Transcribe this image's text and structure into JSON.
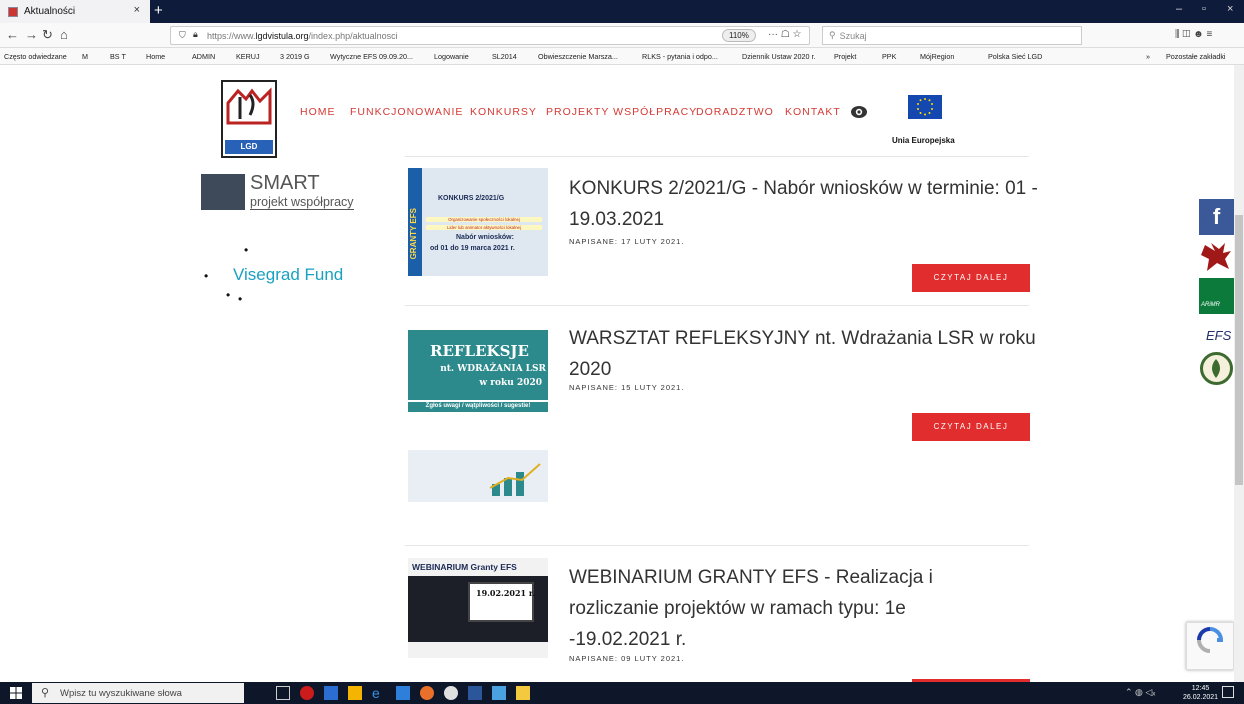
{
  "browser": {
    "tab_title": "Aktualności",
    "tab_close": "×",
    "new_tab": "+",
    "url_prefix": "https://www.",
    "url_host": "lgdvistula.org",
    "url_path": "/index.php/aktualnosci",
    "zoom": "110%",
    "url_actions": "··· ☖ ☆",
    "search_placeholder": "Szukaj",
    "window_controls": {
      "minimize": "–",
      "maximize": "▫",
      "close": "×"
    },
    "right_tools": "⫼ ◫ ☻ ≡"
  },
  "bookmarks": [
    "Często odwiedzane",
    "M",
    "BS T",
    "Home",
    "ADMIN",
    "KERUJ",
    "3 2019 G",
    "Wytyczne EFS 09.09.20...",
    "Logowanie",
    "SL2014",
    "Obwieszczenie Marsza...",
    "RLKS - pytania i odpo...",
    "Dziennik Ustaw 2020 r.",
    "Projekt",
    "PPK",
    "MójRegion",
    "Polska Sieć LGD"
  ],
  "bookmarks_overflow": "»",
  "bookmarks_other": "Pozostałe zakładki",
  "site": {
    "logo_text": "LGD",
    "menu": [
      "HOME",
      "FUNKCJONOWANIE",
      "KONKURSY",
      "PROJEKTY WSPÓŁPRACY",
      "DORADZTWO",
      "KONTAKT"
    ],
    "eu_label": "Unia Europejska"
  },
  "sidebar": {
    "smart_title": "SMART",
    "smart_subtitle": "projekt współpracy",
    "visegrad": "Visegrad Fund",
    "bullet": "•"
  },
  "posts": [
    {
      "title": "KONKURS 2/2021/G - Nabór wniosków w terminie: 01 - 19.03.2021",
      "date": "NAPISANE: 17 LUTY 2021.",
      "button": "CZYTAJ DALEJ",
      "thumb": {
        "side_label": "GRANTY EFS",
        "heading": "KONKURS 2/2021/G",
        "sub1": "Organizowanie społeczności lokalnej",
        "sub2": "Lider lub animator aktywności lokalnej",
        "cta": "Nabór wniosków:",
        "dates": "od 01 do 19 marca 2021 r."
      }
    },
    {
      "title": "WARSZTAT REFLEKSYJNY nt. Wdrażania LSR w roku 2020",
      "date": "NAPISANE: 15 LUTY 2021.",
      "button": "CZYTAJ DALEJ",
      "thumb": {
        "line1": "REFLEKSJE",
        "line2": "nt. WDRAŻANIA LSR",
        "line3": "w roku 2020",
        "cta": "Zgłoś uwagi / wątpliwości / sugestie!"
      }
    },
    {
      "title": "WEBINARIUM GRANTY EFS - Realizacja i rozliczanie projektów w ramach typu: 1e -19.02.2021 r.",
      "date": "NAPISANE: 09 LUTY 2021.",
      "thumb": {
        "heading": "WEBINARIUM Granty EFS",
        "date": "19.02.2021 r."
      }
    }
  ],
  "side_icons": [
    "facebook-icon",
    "coat-of-arms-icon",
    "arimr-icon",
    "efs-icon",
    "emblem-icon"
  ],
  "side_labels": {
    "facebook": "f",
    "arimr": "ARiMR",
    "efs": "EFS"
  },
  "taskbar": {
    "search_placeholder": "Wpisz tu wyszukiwane słowa",
    "time": "12:45",
    "date": "26.02.2021"
  },
  "colors": {
    "accent_red": "#e12d2d",
    "menu_red": "#d43a34",
    "link_blue": "#1aa1c2",
    "taskbar": "#0d1729"
  }
}
